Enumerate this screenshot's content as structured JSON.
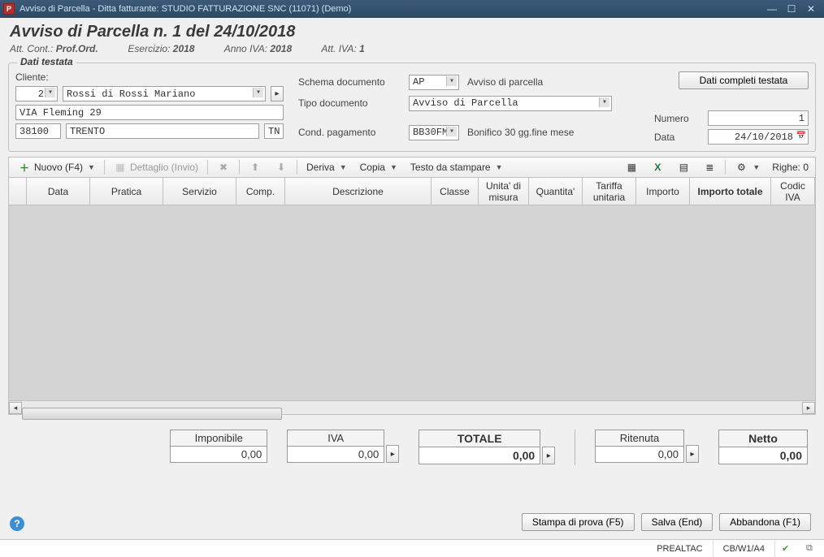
{
  "window": {
    "title": "Avviso di Parcella - Ditta fatturante: STUDIO FATTURAZIONE SNC (11071)  (Demo)"
  },
  "header": {
    "main": "Avviso di Parcella n. 1 del 24/10/2018",
    "att_cont_label": "Att. Cont.:",
    "att_cont_value": "Prof.Ord.",
    "esercizio_label": "Esercizio:",
    "esercizio_value": "2018",
    "anno_iva_label": "Anno IVA:",
    "anno_iva_value": "2018",
    "att_iva_label": "Att. IVA:",
    "att_iva_value": "1"
  },
  "testata": {
    "legend": "Dati testata",
    "cliente_label": "Cliente:",
    "cliente_code": "2",
    "cliente_name": "Rossi di Rossi Mariano",
    "addr_street": "VIA Fleming 29",
    "addr_zip": "38100",
    "addr_city": "TRENTO",
    "addr_prov": "TN",
    "schema_label": "Schema documento",
    "schema_code": "AP",
    "schema_desc": "Avviso di parcella",
    "tipo_label": "Tipo documento",
    "tipo_value": "Avviso di Parcella",
    "cond_label": "Cond. pagamento",
    "cond_code": "BB30FM",
    "cond_desc": "Bonifico 30 gg.fine mese",
    "dati_completi_btn": "Dati completi testata",
    "numero_label": "Numero",
    "numero_value": "1",
    "data_label": "Data",
    "data_value": "24/10/2018"
  },
  "toolbar": {
    "nuovo": "Nuovo (F4)",
    "dettaglio": "Dettaglio (Invio)",
    "deriva": "Deriva",
    "copia": "Copia",
    "testo": "Testo da stampare",
    "righe_label": "Righe:",
    "righe_value": "0"
  },
  "grid": {
    "cols": [
      "",
      "Data",
      "Pratica",
      "Servizio",
      "Comp.",
      "Descrizione",
      "Classe",
      "Unita' di misura",
      "Quantita'",
      "Tariffa unitaria",
      "Importo",
      "Importo totale",
      "Codic IVA"
    ]
  },
  "totals": {
    "imponibile_label": "Imponibile",
    "imponibile_value": "0,00",
    "iva_label": "IVA",
    "iva_value": "0,00",
    "totale_label": "TOTALE",
    "totale_value": "0,00",
    "ritenuta_label": "Ritenuta",
    "ritenuta_value": "0,00",
    "netto_label": "Netto",
    "netto_value": "0,00"
  },
  "buttons": {
    "stampa": "Stampa di prova (F5)",
    "salva": "Salva (End)",
    "abbandona": "Abbandona (F1)"
  },
  "status": {
    "user": "PREALTAC",
    "cfg": "CB/W1/A4"
  }
}
